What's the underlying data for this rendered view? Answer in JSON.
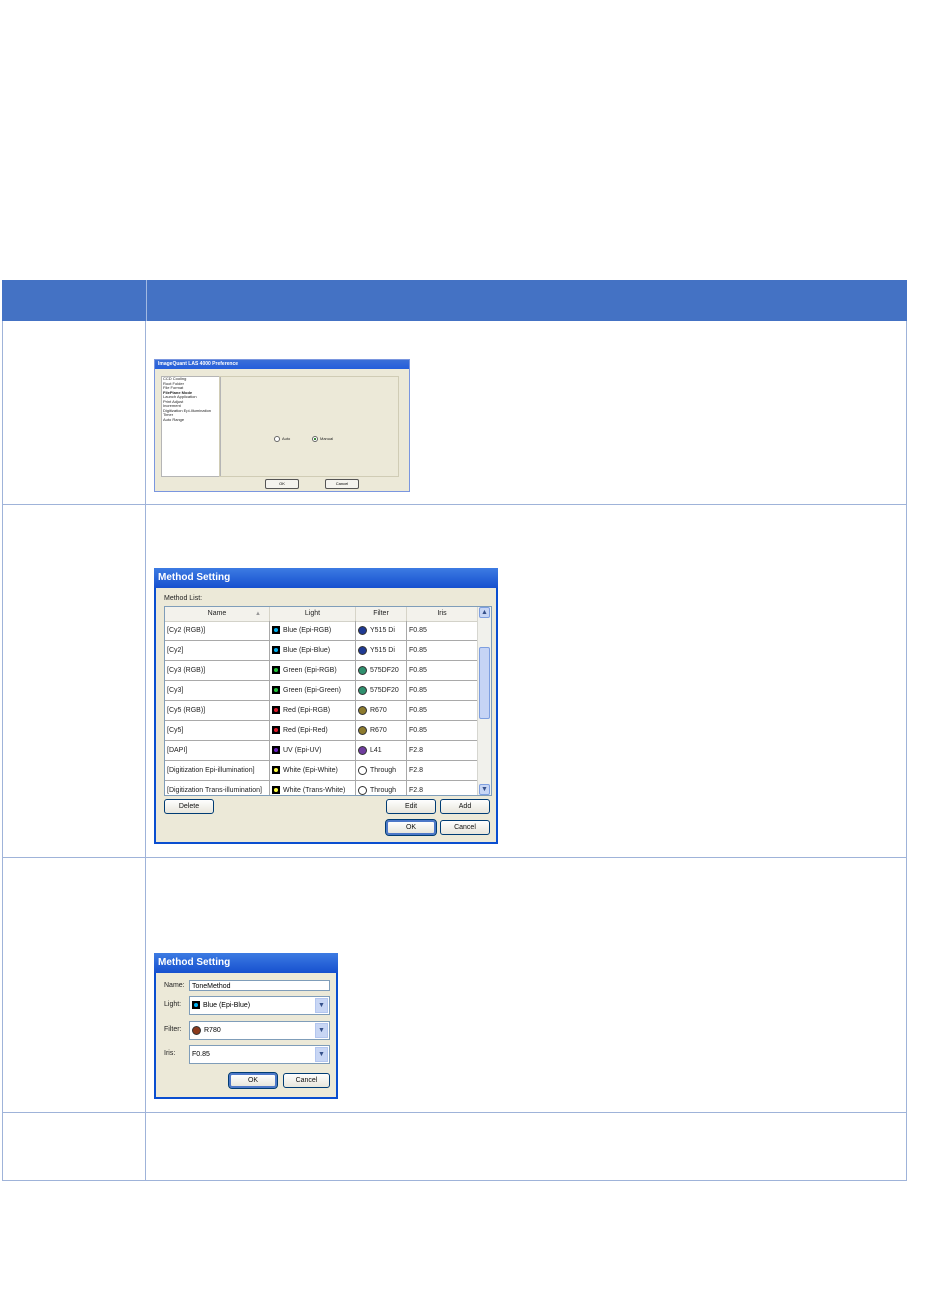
{
  "preference_dialog": {
    "title": "ImageQuant LAS 4000 Preference",
    "menu_items": [
      "CCD Cooling",
      "Root Folder",
      "File Format",
      "FilePlane Mode",
      "Launch Application",
      "Print Adjust",
      "Increment",
      "Digitization Epi-Illumination",
      "Timer",
      "Auto Range"
    ],
    "radio_auto": "Auto",
    "radio_manual": "Manual",
    "ok_label": "OK",
    "cancel_label": "Cancel"
  },
  "method_list_dialog": {
    "title": "Method Setting",
    "list_label": "Method List:",
    "columns": [
      "Name",
      "Light",
      "Filter",
      "Iris"
    ],
    "rows": [
      {
        "name": "[Cy2 (RGB)]",
        "light": "Blue (Epi-RGB)",
        "light_color": "#00b0f0",
        "filter": "Y515 Di",
        "filter_color": "#1f3a93",
        "iris": "F0.85"
      },
      {
        "name": "[Cy2]",
        "light": "Blue (Epi-Blue)",
        "light_color": "#00b0f0",
        "filter": "Y515 Di",
        "filter_color": "#1f3a93",
        "iris": "F0.85"
      },
      {
        "name": "[Cy3 (RGB)]",
        "light": "Green (Epi-RGB)",
        "light_color": "#22c63a",
        "filter": "575DF20",
        "filter_color": "#2f8f6e",
        "iris": "F0.85"
      },
      {
        "name": "[Cy3]",
        "light": "Green (Epi-Green)",
        "light_color": "#22c63a",
        "filter": "575DF20",
        "filter_color": "#2f8f6e",
        "iris": "F0.85"
      },
      {
        "name": "[Cy5 (RGB)]",
        "light": "Red (Epi-RGB)",
        "light_color": "#e0192a",
        "filter": "R670",
        "filter_color": "#8c7a2e",
        "iris": "F0.85"
      },
      {
        "name": "[Cy5]",
        "light": "Red (Epi-Red)",
        "light_color": "#e0192a",
        "filter": "R670",
        "filter_color": "#8c7a2e",
        "iris": "F0.85"
      },
      {
        "name": "[DAPI]",
        "light": "UV (Epi-UV)",
        "light_color": "#6a1fc4",
        "filter": "L41",
        "filter_color": "#6f3d9e",
        "iris": "F2.8"
      },
      {
        "name": "[Digitization Epi-illumination]",
        "light": "White (Epi-White)",
        "light_color": "#ffff40",
        "filter": "Through",
        "filter_color": "#ffffff",
        "iris": "F2.8"
      },
      {
        "name": "[Digitization Trans-illumination]",
        "light": "White (Trans-White)",
        "light_color": "#ffff40",
        "filter": "Through",
        "filter_color": "#ffffff",
        "iris": "F2.8"
      }
    ],
    "delete_label": "Delete",
    "edit_label": "Edit",
    "add_label": "Add",
    "ok_label": "OK",
    "cancel_label": "Cancel"
  },
  "method_edit_dialog": {
    "title": "Method Setting",
    "name_label": "Name:",
    "name_value": "ToneMethod",
    "light_label": "Light:",
    "light_value": "Blue (Epi-Blue)",
    "light_color": "#00b0f0",
    "filter_label": "Filter:",
    "filter_value": "R780",
    "filter_color": "#8b3a1c",
    "iris_label": "Iris:",
    "iris_value": "F0.85",
    "ok_label": "OK",
    "cancel_label": "Cancel"
  }
}
